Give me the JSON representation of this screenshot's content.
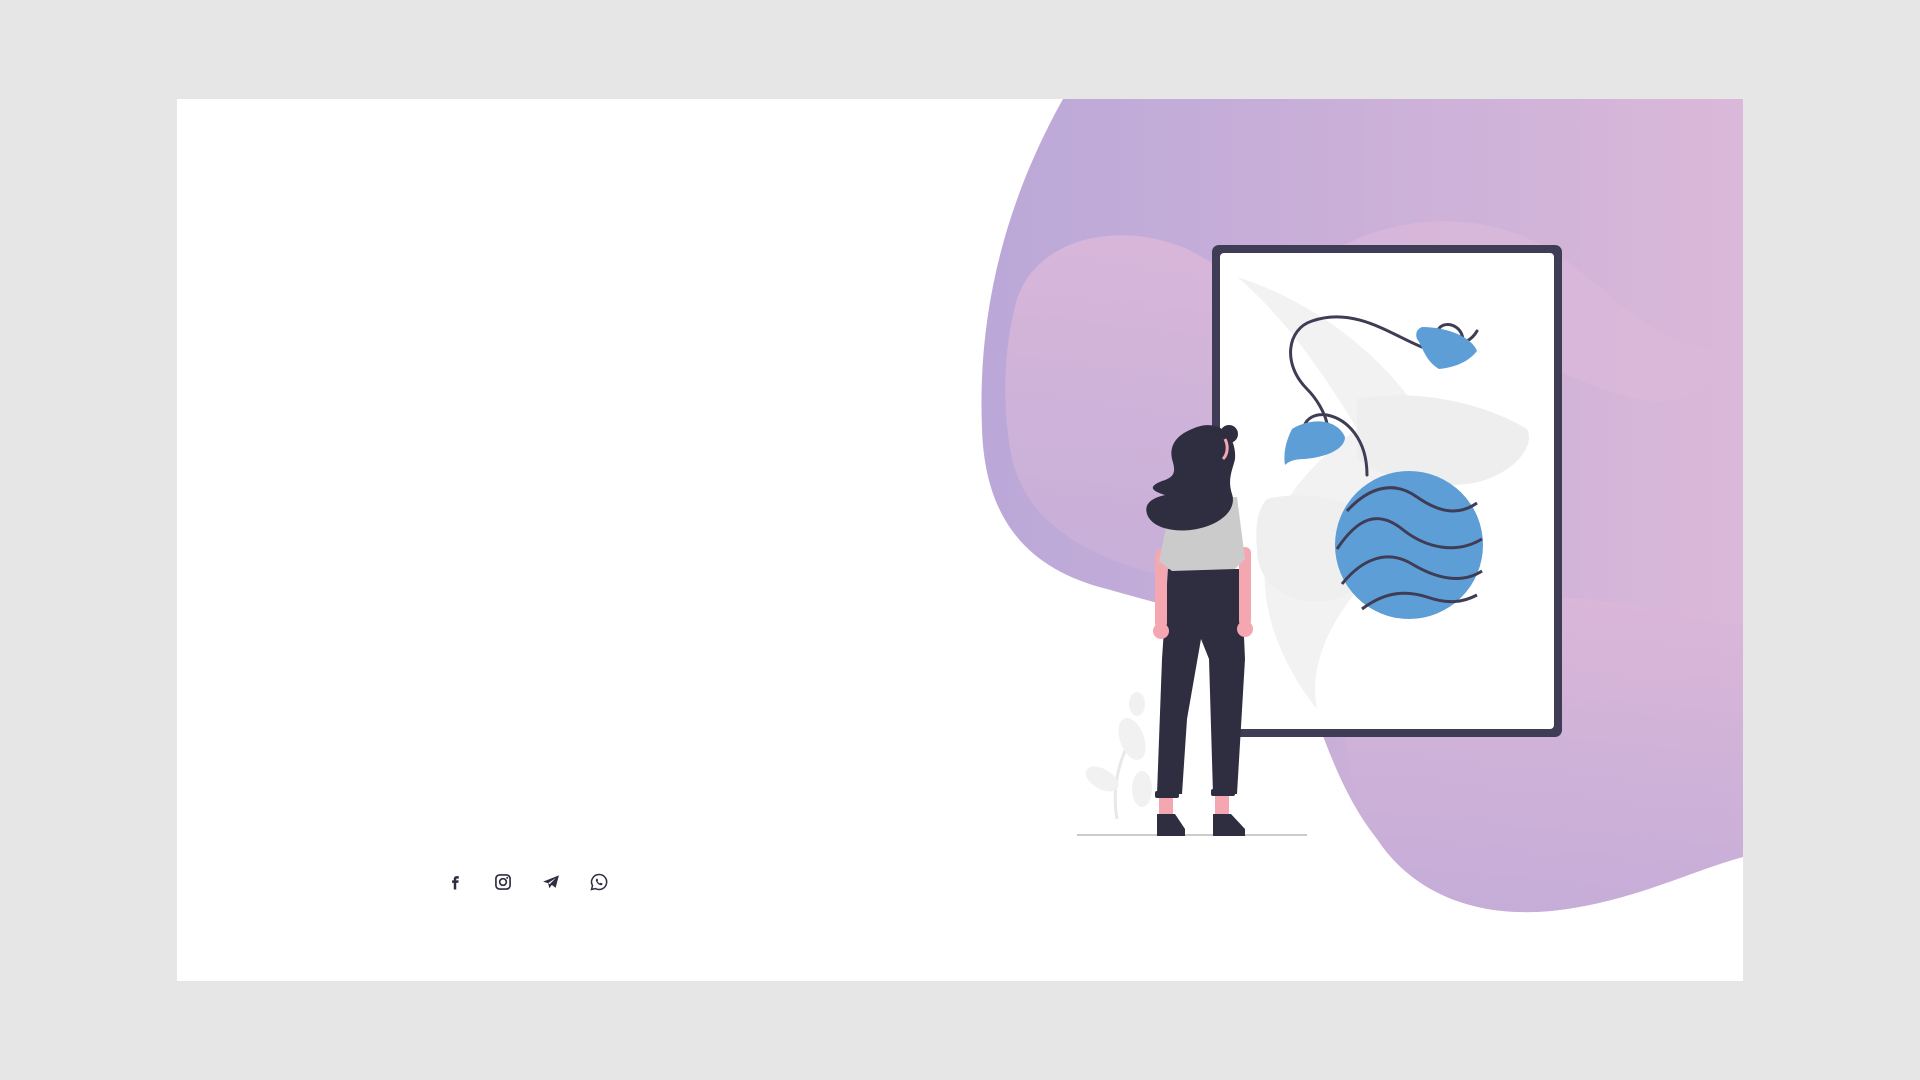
{
  "theme": {
    "page_background": "#e6e6e6",
    "card_background": "#ffffff",
    "blob_gradient_start": "#bba8d8",
    "blob_gradient_end": "#dab8d9",
    "inner_blob_color": "#d8b4da",
    "frame_color": "#3f3d56",
    "accent_blue": "#5e9ed7",
    "dark_figure": "#2f2e41",
    "skin": "#f4a7b0",
    "shirt": "#cbcbcb"
  },
  "social": [
    {
      "name": "facebook",
      "icon": "facebook-icon"
    },
    {
      "name": "instagram",
      "icon": "instagram-icon"
    },
    {
      "name": "telegram",
      "icon": "telegram-icon"
    },
    {
      "name": "whatsapp",
      "icon": "whatsapp-icon"
    }
  ]
}
